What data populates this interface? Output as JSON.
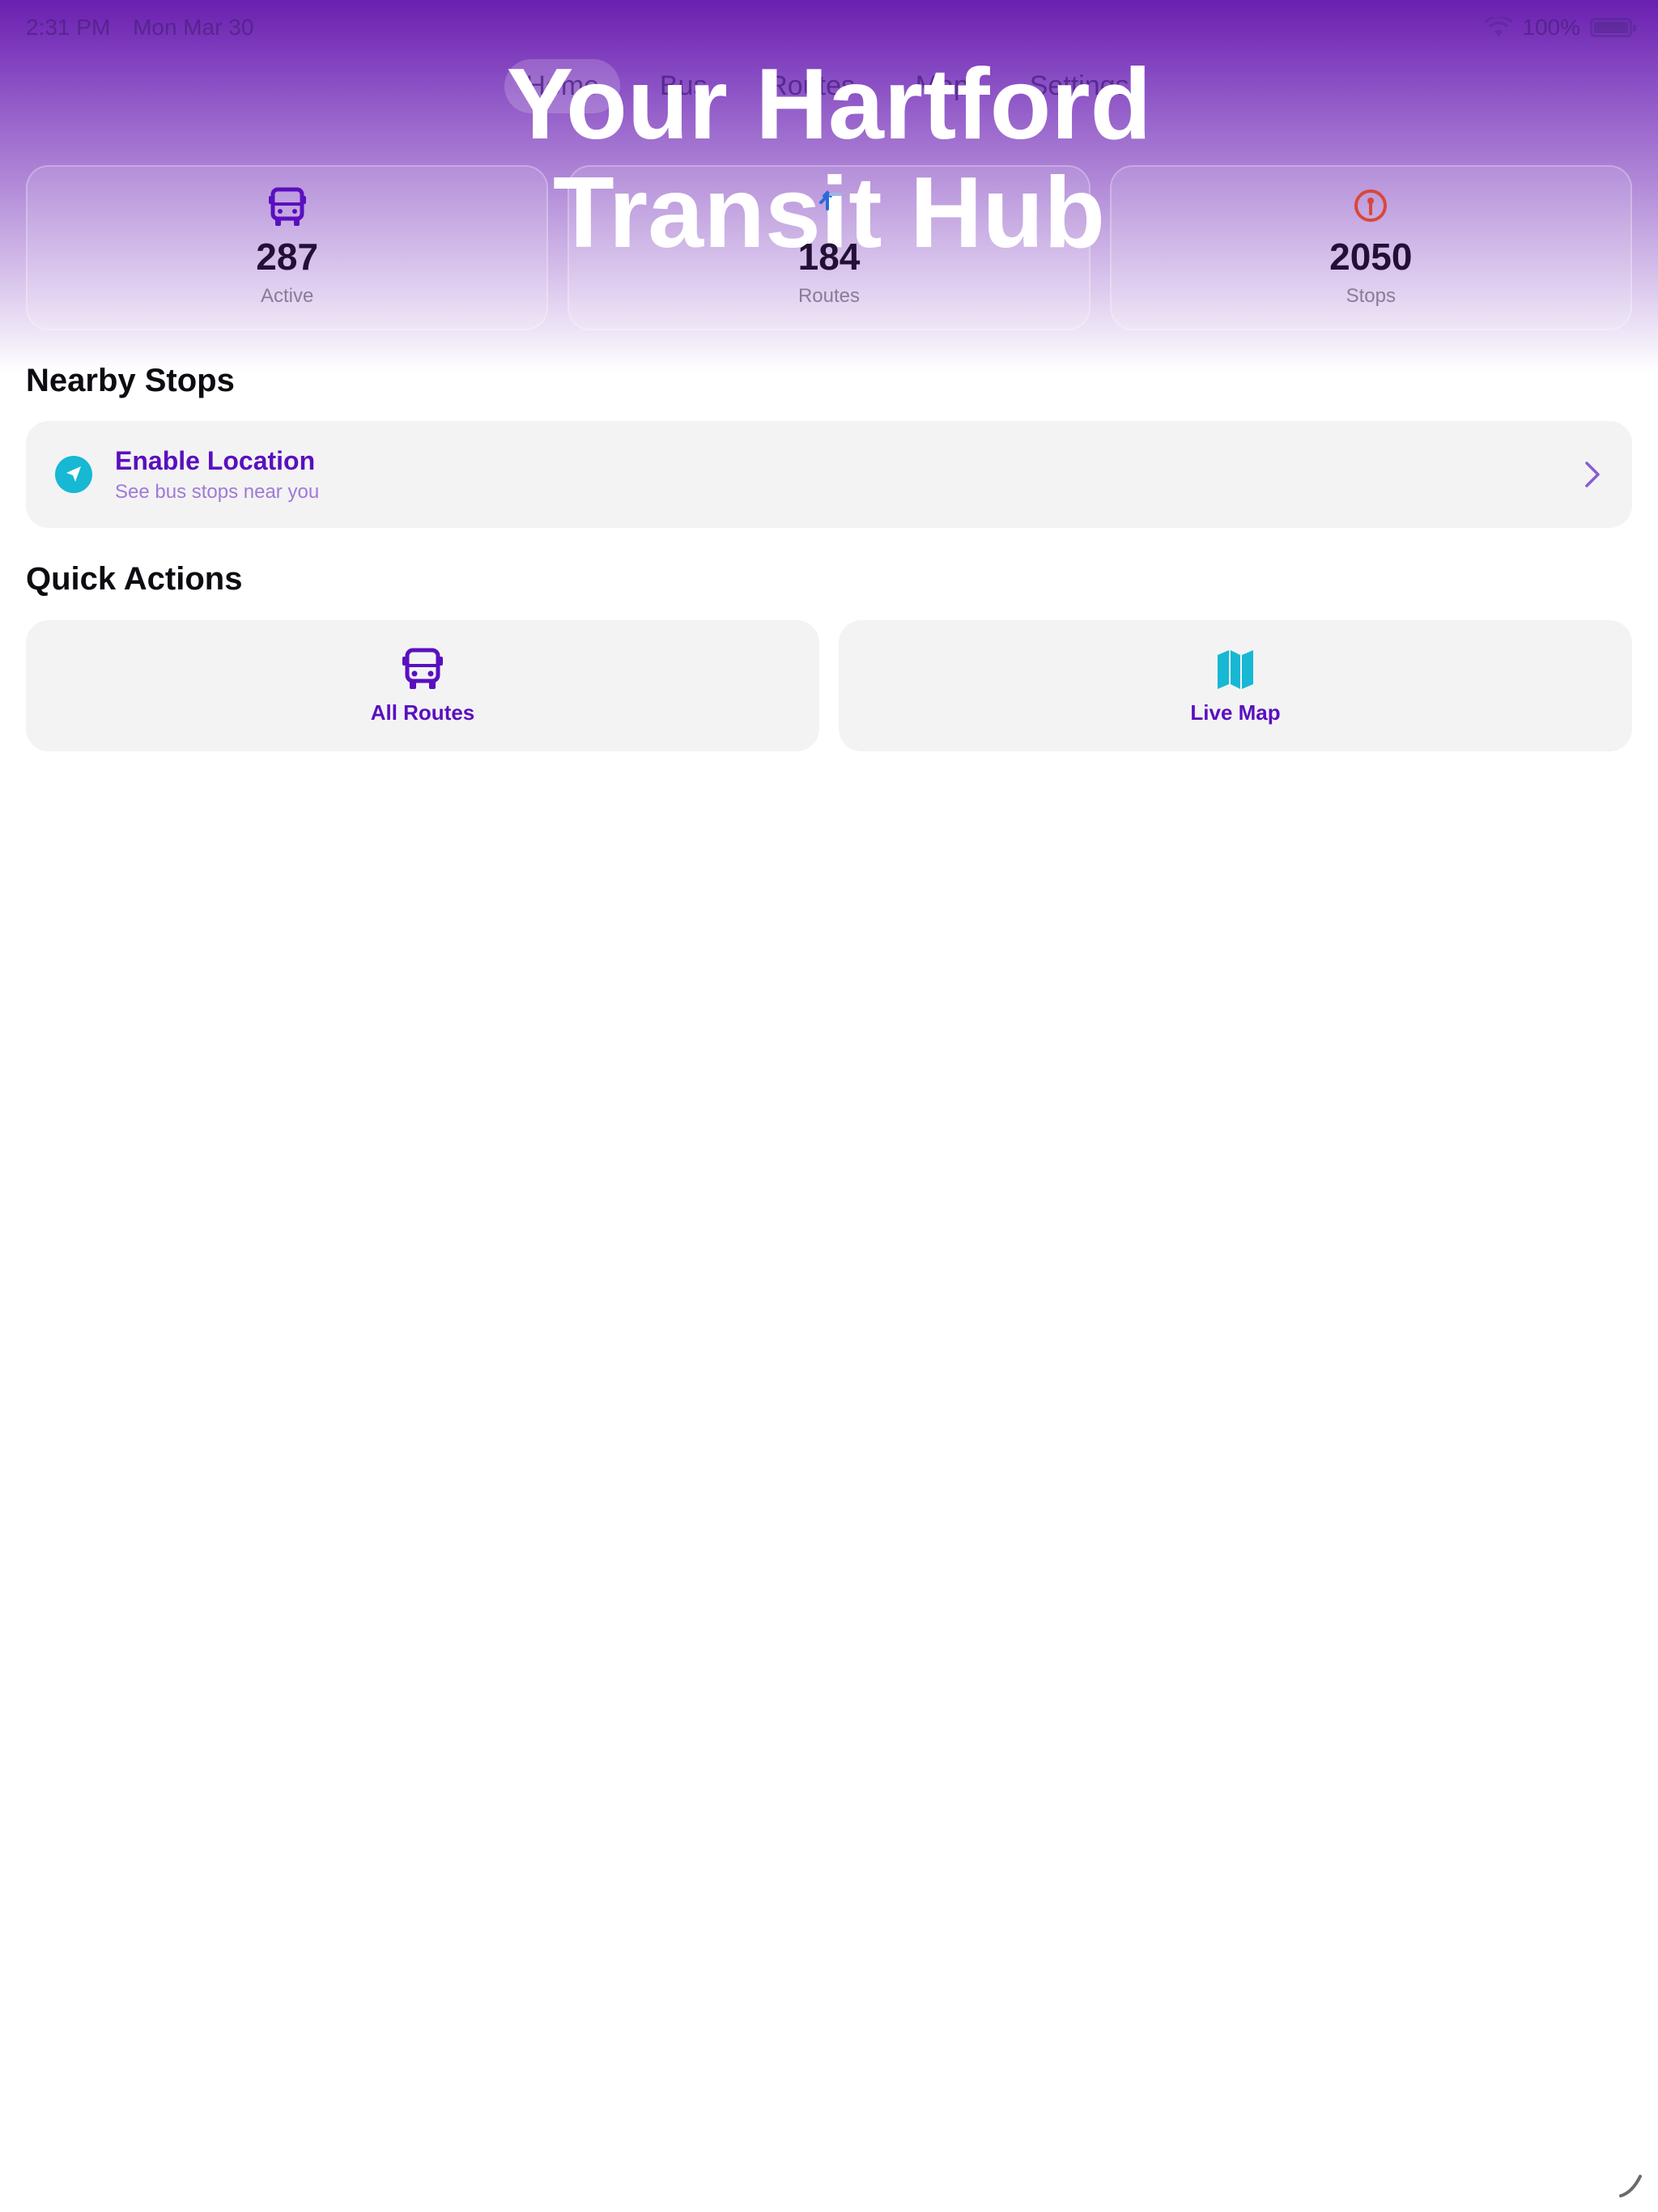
{
  "status_bar": {
    "time": "2:31 PM",
    "date": "Mon Mar 30",
    "battery": "100%"
  },
  "tabs": [
    {
      "label": "Home"
    },
    {
      "label": "Bus"
    },
    {
      "label": "Routes"
    },
    {
      "label": "Map"
    },
    {
      "label": "Settings"
    }
  ],
  "hero": {
    "line1": "Your Hartford",
    "line2": "Transit Hub"
  },
  "stats": [
    {
      "value": "287",
      "label": "Active",
      "icon": "bus-icon"
    },
    {
      "value": "184",
      "label": "Routes",
      "icon": "route-icon"
    },
    {
      "value": "2050",
      "label": "Stops",
      "icon": "pin-icon"
    }
  ],
  "sections": {
    "nearby": "Nearby Stops",
    "quick": "Quick Actions"
  },
  "location_card": {
    "title": "Enable Location",
    "subtitle": "See bus stops near you"
  },
  "quick_actions": [
    {
      "label": "All Routes",
      "icon": "bus-icon"
    },
    {
      "label": "Live Map",
      "icon": "map-icon"
    }
  ],
  "colors": {
    "accent": "#5a0fbf",
    "teal": "#17b8d4",
    "stop_red": "#d9473b"
  }
}
